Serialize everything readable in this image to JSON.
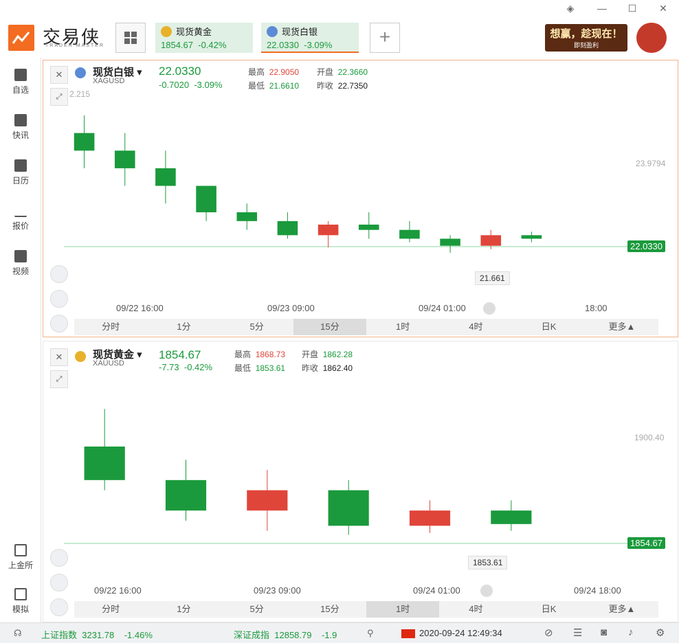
{
  "app": {
    "name": "交易侠",
    "subtitle": "TRADER MASTER"
  },
  "tabs": [
    {
      "name": "现货黄金",
      "price": "1854.67",
      "change_pct": "-0.42%"
    },
    {
      "name": "现货白银",
      "price": "22.0330",
      "change_pct": "-3.09%"
    }
  ],
  "add_tab_label": "+",
  "promo": {
    "line1": "想赢，趁现在！",
    "line2": "即刻盈利"
  },
  "window_controls": [
    "layer-icon",
    "minimize-icon",
    "maximize-icon",
    "close-icon"
  ],
  "sidebar": {
    "items": [
      {
        "label": "自选",
        "icon": "bookmark-icon"
      },
      {
        "label": "快讯",
        "icon": "news-icon"
      },
      {
        "label": "日历",
        "icon": "calendar-icon"
      },
      {
        "label": "报价",
        "icon": "quote-icon"
      },
      {
        "label": "视频",
        "icon": "video-icon"
      },
      {
        "label": "上金所",
        "icon": "exchange-icon"
      },
      {
        "label": "模拟",
        "icon": "simulate-icon"
      }
    ]
  },
  "panel1": {
    "name": "现货白银",
    "code": "XAGUSD",
    "price": "22.0330",
    "change": "-0.7020",
    "change_pct": "-3.09%",
    "high_label": "最高",
    "high": "22.9050",
    "open_label": "开盘",
    "open": "22.3660",
    "low_label": "最低",
    "low": "21.6610",
    "prev_label": "昨收",
    "prev": "22.7350",
    "y_tick": "23.9794",
    "y_tick_top": "2.215",
    "price_tag": "22.0330",
    "low_tag": "21.661",
    "x_labels": [
      "09/22 16:00",
      "09/23 09:00",
      "09/24 01:00",
      "18:00"
    ],
    "periods": [
      "分时",
      "1分",
      "5分",
      "15分",
      "1时",
      "4时",
      "日K",
      "更多▲"
    ],
    "selected_period": "15分"
  },
  "panel2": {
    "name": "现货黄金",
    "code": "XAUUSD",
    "price": "1854.67",
    "change": "-7.73",
    "change_pct": "-0.42%",
    "high_label": "最高",
    "high": "1868.73",
    "open_label": "开盘",
    "open": "1862.28",
    "low_label": "最低",
    "low": "1853.61",
    "prev_label": "昨收",
    "prev": "1862.40",
    "y_tick": "1900.40",
    "price_tag": "1854.67",
    "low_tag": "1853.61",
    "x_labels": [
      "09/22 16:00",
      "09/23 09:00",
      "09/24 01:00",
      "09/24 18:00"
    ],
    "periods": [
      "分时",
      "1分",
      "5分",
      "15分",
      "1时",
      "4时",
      "日K",
      "更多▲"
    ],
    "selected_period": "1时"
  },
  "statusbar": {
    "idx1_name": "上证指数",
    "idx1_val": "3231.78",
    "idx1_chg": "-1.46%",
    "idx2_name": "深证成指",
    "idx2_val": "12858.79",
    "idx2_chg": "-1.9",
    "datetime": "2020-09-24 12:49:34"
  },
  "colors": {
    "up": "#e0453a",
    "down": "#1a9a3c",
    "accent": "#f36c21"
  },
  "chart_data": [
    {
      "type": "candlestick",
      "title": "现货白银",
      "series": [
        {
          "name": "XAGUSD",
          "ohlc": [
            [
              22.3,
              22.4,
              22.1,
              22.2
            ],
            [
              22.2,
              22.3,
              22.0,
              22.1
            ],
            [
              22.1,
              22.2,
              21.9,
              22.0
            ],
            [
              22.0,
              22.0,
              21.8,
              21.85
            ],
            [
              21.85,
              21.9,
              21.75,
              21.8
            ],
            [
              21.8,
              21.85,
              21.7,
              21.72
            ],
            [
              21.72,
              21.8,
              21.65,
              21.78
            ],
            [
              21.78,
              21.85,
              21.7,
              21.75
            ],
            [
              21.75,
              21.8,
              21.68,
              21.7
            ],
            [
              21.7,
              21.72,
              21.62,
              21.66
            ],
            [
              21.66,
              21.75,
              21.64,
              21.72
            ],
            [
              21.72,
              21.74,
              21.68,
              21.7
            ]
          ]
        }
      ]
    },
    {
      "type": "candlestick",
      "title": "现货黄金",
      "series": [
        {
          "name": "XAUUSD",
          "ohlc": [
            [
              1862.3,
              1866,
              1858,
              1859
            ],
            [
              1859,
              1861,
              1855,
              1856
            ],
            [
              1856,
              1860,
              1854,
              1858
            ],
            [
              1858,
              1859,
              1853.6,
              1854.5
            ],
            [
              1854.5,
              1857,
              1853.8,
              1856
            ],
            [
              1856,
              1857,
              1854,
              1854.67
            ]
          ]
        }
      ]
    }
  ]
}
